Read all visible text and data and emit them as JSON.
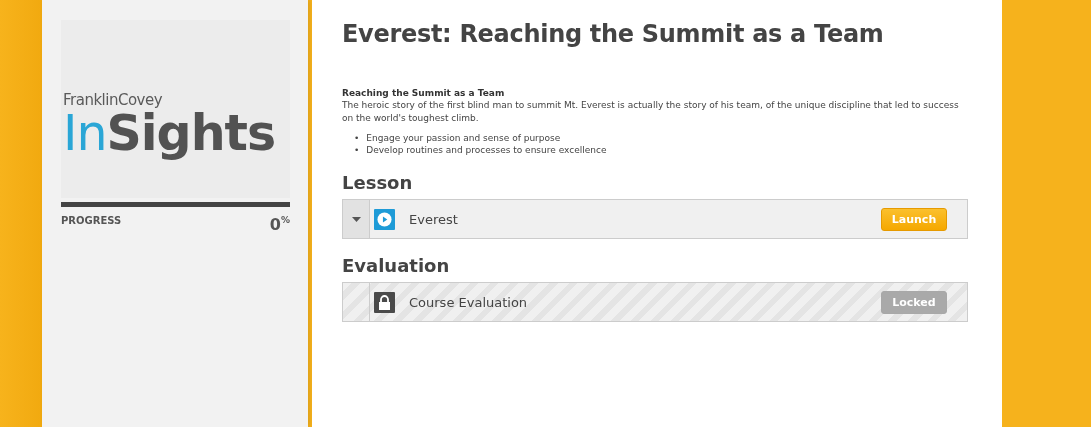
{
  "sidebar": {
    "logo": {
      "brand": "FranklinCovey",
      "product_prefix": "In",
      "product_rest": "Sights"
    },
    "progress": {
      "label": "PROGRESS",
      "value": "0",
      "unit": "%",
      "level": 0
    }
  },
  "course": {
    "title": "Everest: Reaching the Summit as a Team",
    "summary_heading": "Reaching the Summit as a Team",
    "summary": "The heroic story of the first blind man to summit Mt. Everest is actually the story of his team, of the unique discipline that led to success on the world's toughest climb.",
    "bullets": [
      {
        "marker": "•",
        "text": "Engage your passion and sense of purpose"
      },
      {
        "marker": "•",
        "text": "Develop routines and processes to ensure excellence"
      }
    ]
  },
  "sections": [
    {
      "heading": "Lesson",
      "items": [
        {
          "kind": "video",
          "title": "Everest",
          "button": "Launch",
          "locked": false,
          "expanded": false
        }
      ]
    },
    {
      "heading": "Evaluation",
      "items": [
        {
          "kind": "locked",
          "title": "Course Evaluation",
          "button": "Locked",
          "locked": true
        }
      ]
    }
  ]
}
